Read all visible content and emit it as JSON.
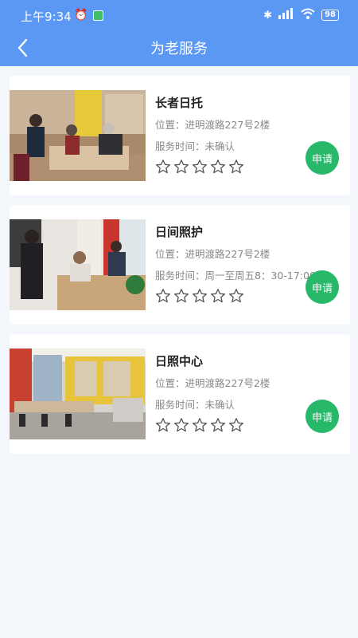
{
  "status_bar": {
    "time": "上午9:34",
    "signal": "HD",
    "battery": "98"
  },
  "header": {
    "title": "为老服务"
  },
  "services": [
    {
      "name": "长者日托",
      "location": "位置：进明渡路227号2楼",
      "service_time": "服务时间：未确认",
      "rating": 0,
      "apply_label": "申请",
      "image": "daycare-room-photo"
    },
    {
      "name": "日间照护",
      "location": "位置：进明渡路227号2楼",
      "service_time": "服务时间：周一至周五8：30-17:00",
      "rating": 0,
      "apply_label": "申请",
      "image": "care-reception-photo"
    },
    {
      "name": "日照中心",
      "location": "位置：进明渡路227号2楼",
      "service_time": "服务时间：未确认",
      "rating": 0,
      "apply_label": "申请",
      "image": "center-interior-photo"
    }
  ],
  "icons": {
    "back": "back-arrow-icon",
    "star": "star-outline-icon"
  },
  "colors": {
    "header": "#5b98f4",
    "apply": "#27b86a",
    "background": "#f3f6fb"
  }
}
